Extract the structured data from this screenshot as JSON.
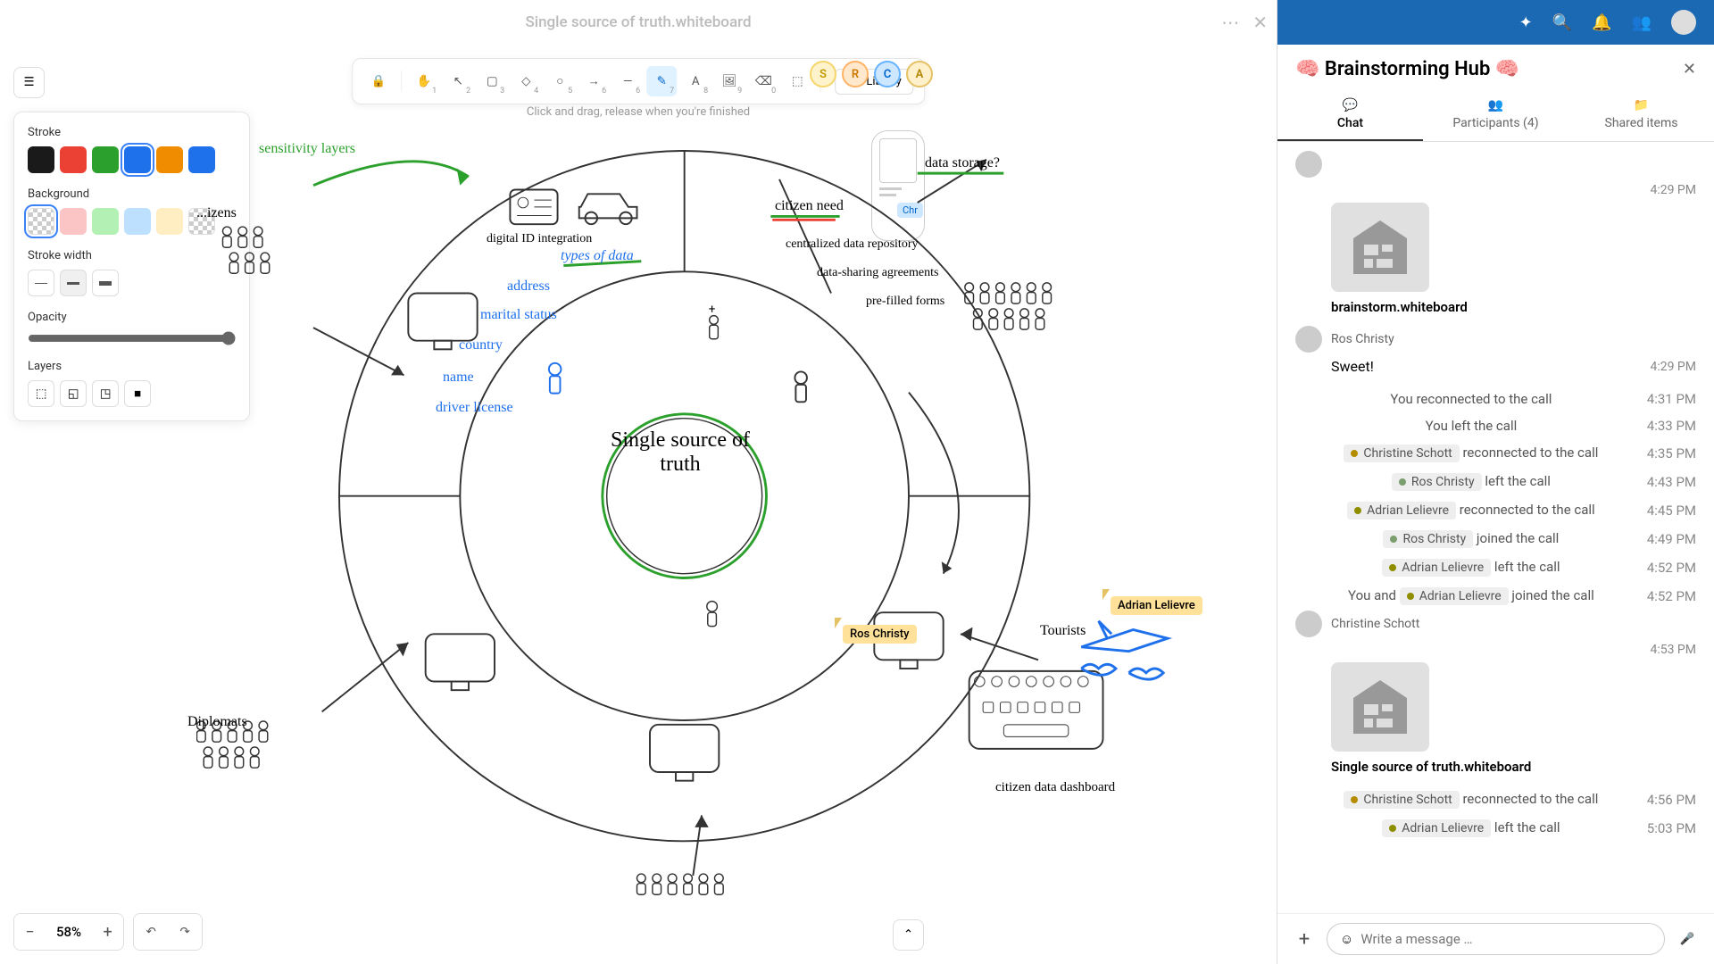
{
  "page_title": "Single source of truth.whiteboard",
  "hint": "Click and drag, release when you're finished",
  "library_label": "Library",
  "zoom_level": "58%",
  "avatars": [
    "S",
    "R",
    "C",
    "A"
  ],
  "style_panel": {
    "stroke_label": "Stroke",
    "stroke_colors": [
      "#1a1a1a",
      "#eb4034",
      "#2ca02c",
      "#1e70eb",
      "#f08c00",
      "#1e70eb"
    ],
    "stroke_selected": 3,
    "background_label": "Background",
    "bg_colors": [
      "transparent",
      "#fcc5c5",
      "#b3f0b3",
      "#bde0ff",
      "#ffeec2",
      "transparent"
    ],
    "bg_selected": 0,
    "width_label": "Stroke width",
    "opacity_label": "Opacity",
    "layers_label": "Layers"
  },
  "canvas": {
    "center_title": "Single source of truth",
    "annotations": {
      "sensitivity": "sensitivity layers",
      "data_storage": "data storage?",
      "citizen_need": "citizen need",
      "types_of_data": "types of data",
      "digital_id": "digital ID integration",
      "centralized": "centralized data repository",
      "data_sharing": "data-sharing agreements",
      "pre_filled": "pre-filled forms",
      "address": "address",
      "marital": "marital status",
      "country": "country",
      "name": "name",
      "driver": "driver license",
      "citizens": "...izens",
      "diplomats": "Diplomats",
      "tourists": "Tourists",
      "dashboard": "citizen data dashboard"
    },
    "cursors": {
      "ros": "Ros Christy",
      "adrian": "Adrian Lelievre"
    },
    "minimap_label": "Chr"
  },
  "chat": {
    "title": "🧠 Brainstorming Hub 🧠",
    "tabs": {
      "chat": "Chat",
      "participants": "Participants (4)",
      "shared": "Shared items"
    },
    "messages": [
      {
        "type": "attachment",
        "time": "4:29 PM",
        "name": "brainstorm.whiteboard"
      },
      {
        "type": "msg",
        "author": "Ros Christy",
        "time": "4:29 PM",
        "text": "Sweet!"
      },
      {
        "type": "system",
        "text": "You reconnected to the call",
        "time": "4:31 PM"
      },
      {
        "type": "system",
        "text": "You left the call",
        "time": "4:33 PM"
      },
      {
        "type": "system",
        "user": "Christine Schott",
        "color": "#b58c00",
        "action": "reconnected to the call",
        "time": "4:35 PM"
      },
      {
        "type": "system",
        "user": "Ros Christy",
        "color": "#7b9e6e",
        "action": "left the call",
        "time": "4:43 PM"
      },
      {
        "type": "system",
        "user": "Adrian Lelievre",
        "color": "#8e8e00",
        "action": "reconnected to the call",
        "time": "4:45 PM"
      },
      {
        "type": "system",
        "user": "Ros Christy",
        "color": "#7b9e6e",
        "action": "joined the call",
        "time": "4:49 PM"
      },
      {
        "type": "system",
        "user": "Adrian Lelievre",
        "color": "#8e8e00",
        "action": "left the call",
        "time": "4:52 PM"
      },
      {
        "type": "system",
        "prefix": "You and",
        "user": "Adrian Lelievre",
        "color": "#8e8e00",
        "action": "joined the call",
        "time": "4:52 PM"
      },
      {
        "type": "attachment",
        "author": "Christine Schott",
        "time": "4:53 PM",
        "name": "Single source of truth.whiteboard"
      },
      {
        "type": "system",
        "user": "Christine Schott",
        "color": "#b58c00",
        "action": "reconnected to the call",
        "time": "4:56 PM"
      },
      {
        "type": "system",
        "user": "Adrian Lelievre",
        "color": "#8e8e00",
        "action": "left the call",
        "time": "5:03 PM"
      }
    ],
    "input_placeholder": "Write a message …"
  }
}
